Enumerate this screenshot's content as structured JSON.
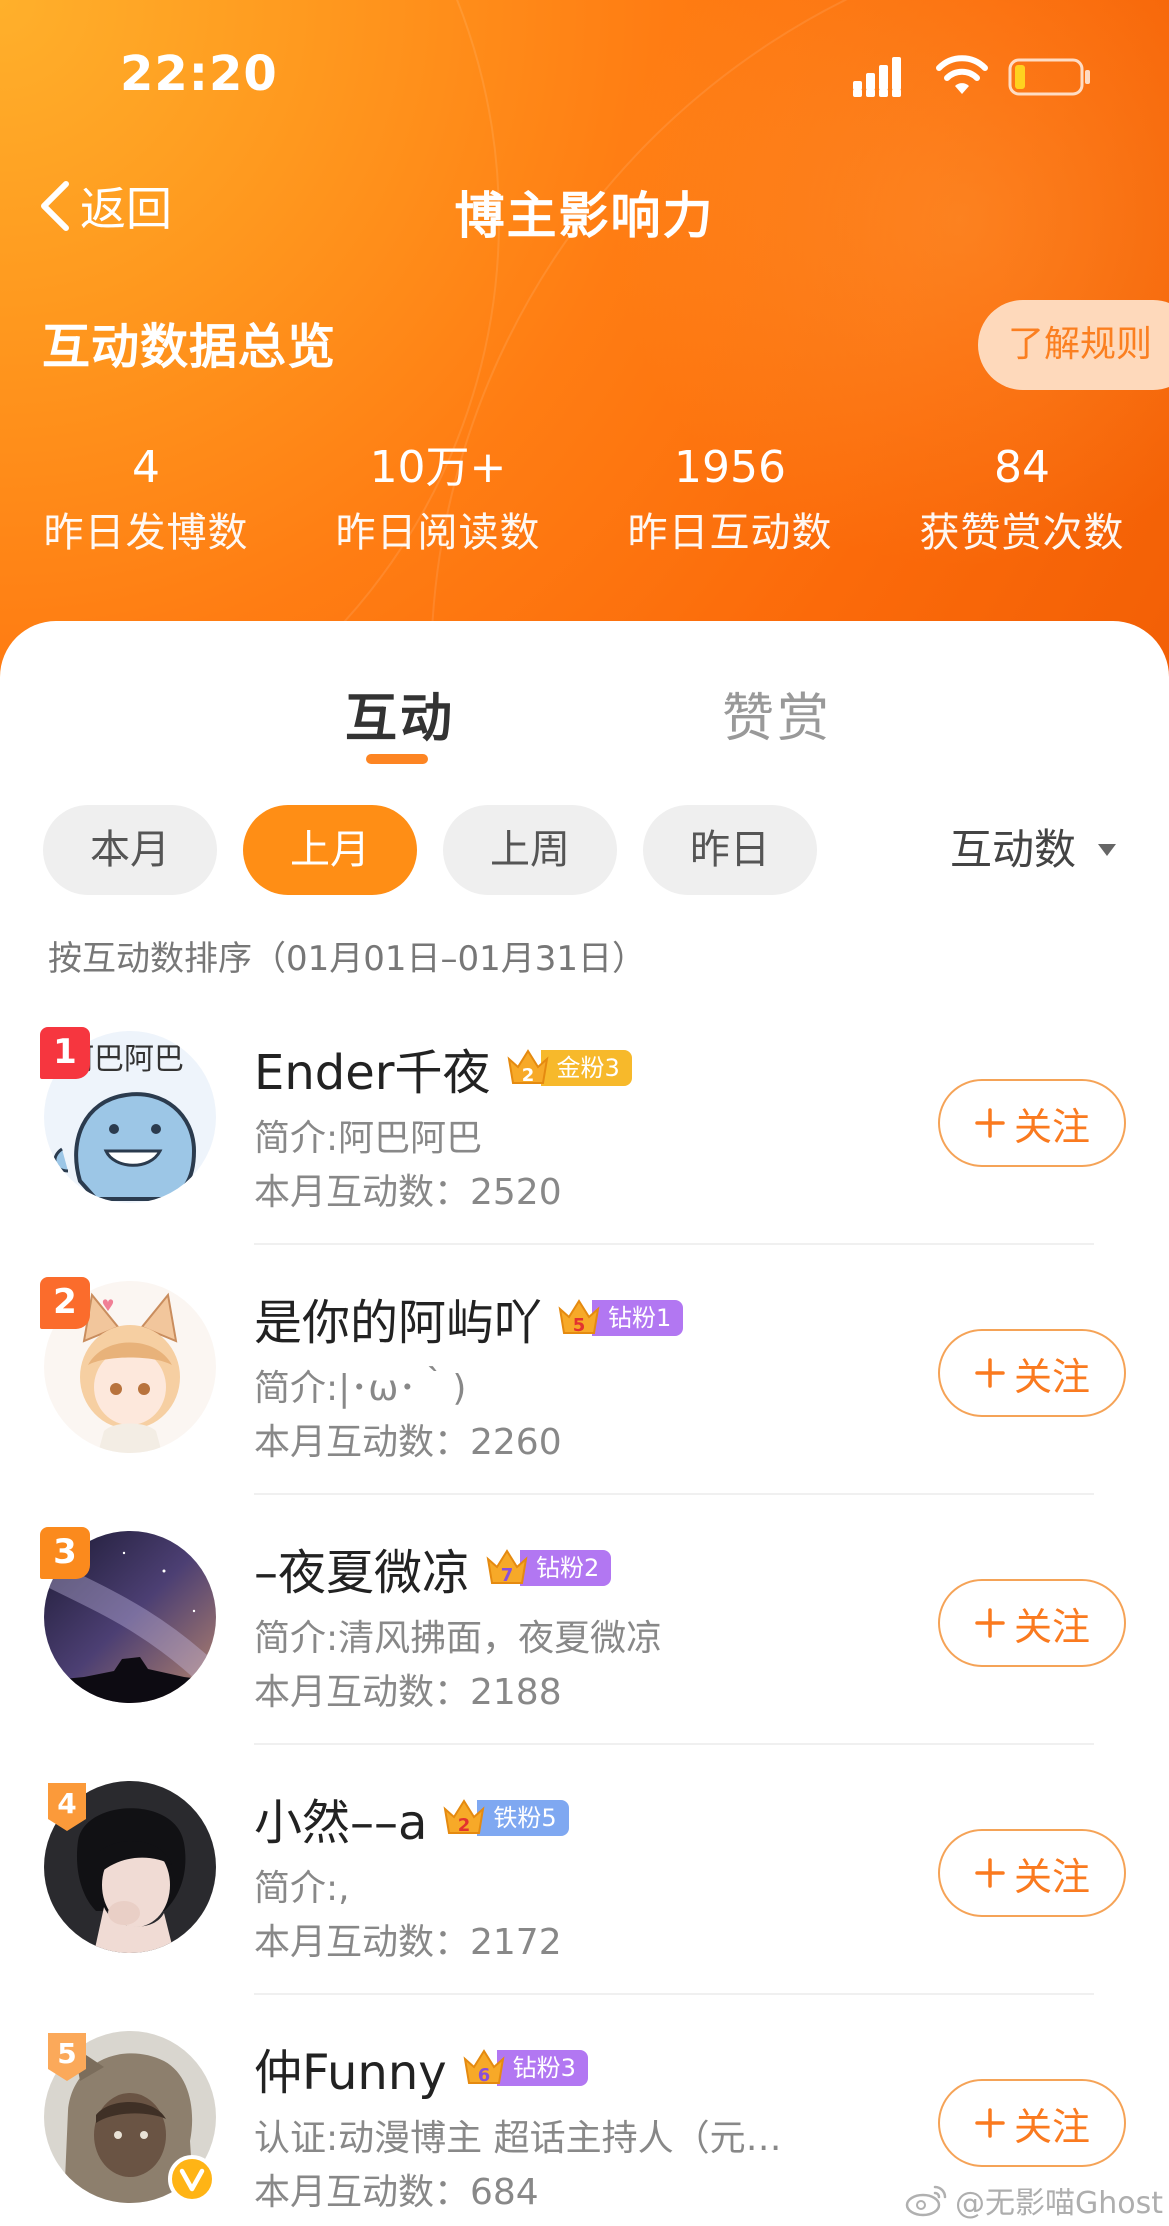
{
  "status_bar": {
    "time": "22:20"
  },
  "nav": {
    "back_label": "返回",
    "title": "博主影响力"
  },
  "overview": {
    "title": "互动数据总览",
    "rules_button": "了解规则",
    "stats": [
      {
        "value": "4",
        "label": "昨日发博数"
      },
      {
        "value": "10万+",
        "label": "昨日阅读数"
      },
      {
        "value": "1956",
        "label": "昨日互动数"
      },
      {
        "value": "84",
        "label": "获赞赏次数"
      }
    ]
  },
  "tabs": [
    {
      "label": "互动",
      "active": true
    },
    {
      "label": "赞赏",
      "active": false
    }
  ],
  "filters": [
    {
      "label": "本月",
      "active": false
    },
    {
      "label": "上月",
      "active": true
    },
    {
      "label": "上周",
      "active": false
    },
    {
      "label": "昨日",
      "active": false
    }
  ],
  "sort": {
    "selected": "互动数",
    "note": "按互动数排序（01月01日–01月31日）"
  },
  "colors": {
    "brand_orange": "#ff8e15",
    "follow_text": "#fa7a1f"
  },
  "fans": [
    {
      "rank": "1",
      "name": "Ender千夜",
      "badge_level": "2",
      "badge_label": "金粉3",
      "badge_color": "#f7b92b",
      "bio": "简介:阿巴阿巴",
      "count": "本月互动数：2520",
      "follow": "关注",
      "avatar_text": "阿巴阿巴"
    },
    {
      "rank": "2",
      "name": "是你的阿屿吖",
      "badge_level": "5",
      "badge_label": "钻粉1",
      "badge_color": "#b277f2",
      "bio": "简介:|･ω･｀)",
      "count": "本月互动数：2260",
      "follow": "关注"
    },
    {
      "rank": "3",
      "name": "–夜夏微凉",
      "badge_level": "7",
      "badge_label": "钻粉2",
      "badge_color": "#b277f2",
      "bio": "简介:清风拂面，夜夏微凉",
      "count": "本月互动数：2188",
      "follow": "关注"
    },
    {
      "rank": "4",
      "name": "小然––a",
      "badge_level": "2",
      "badge_label": "铁粉5",
      "badge_color": "#7fa8f1",
      "bio": "简介:,",
      "count": "本月互动数：2172",
      "follow": "关注"
    },
    {
      "rank": "5",
      "name": "仲Funny",
      "badge_level": "6",
      "badge_label": "钻粉3",
      "badge_color": "#b277f2",
      "bio": "认证:动漫博主 超话主持人（元…",
      "count": "本月互动数：684",
      "follow": "关注"
    }
  ],
  "watermark": "@无影喵Ghost"
}
